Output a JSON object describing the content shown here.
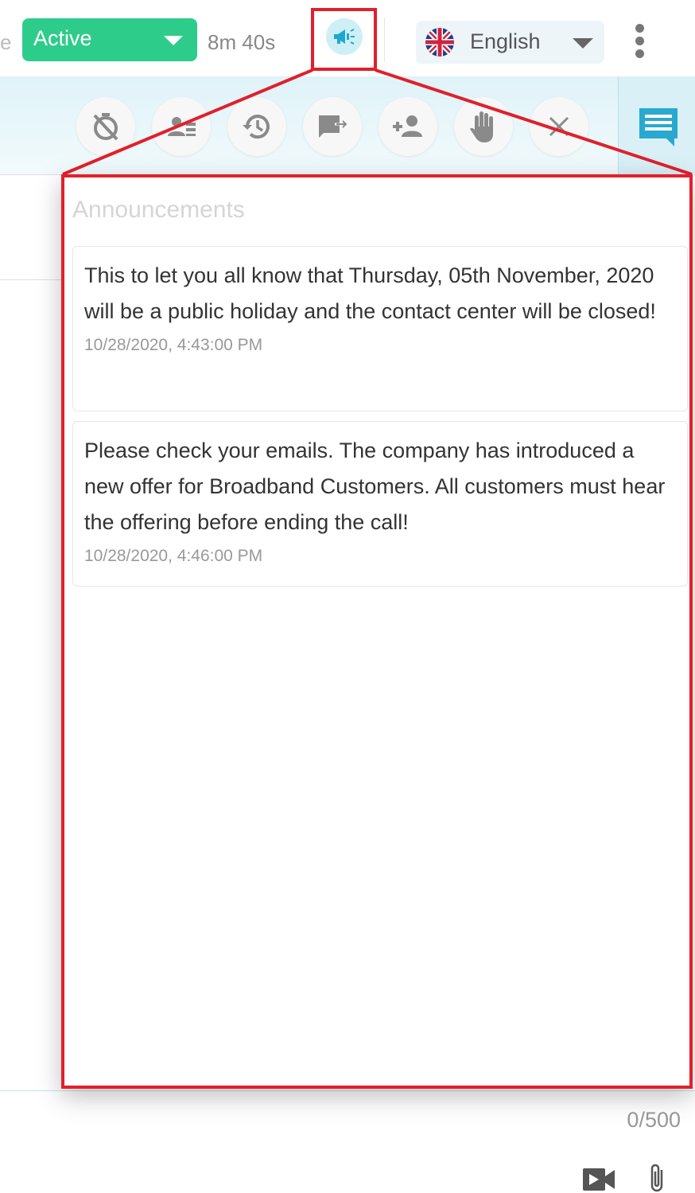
{
  "topbar": {
    "cut_letter": "e",
    "status_value": "Active",
    "timer": "8m 40s",
    "announcements_icon": "megaphone-icon",
    "language_value": "English",
    "language_flag": "uk-flag-icon",
    "more_icon": "kebab-menu-icon"
  },
  "toolbar": {
    "actions": [
      {
        "name": "timer-off-icon"
      },
      {
        "name": "contact-card-icon"
      },
      {
        "name": "history-icon"
      },
      {
        "name": "transfer-icon"
      },
      {
        "name": "add-user-icon"
      },
      {
        "name": "raise-hand-icon"
      },
      {
        "name": "close-icon"
      }
    ],
    "chat_panel_icon": "chat-icon"
  },
  "announcements": {
    "title": "Announcements",
    "items": [
      {
        "message": "This to let you all know that Thursday, 05th November, 2020 will be a public holiday and the contact center will be closed!",
        "timestamp": "10/28/2020, 4:43:00 PM"
      },
      {
        "message": "Please check your emails. The company has introduced a new offer for Broadband Customers. All customers must hear the offering before ending the call!",
        "timestamp": "10/28/2020, 4:46:00 PM"
      }
    ]
  },
  "composer": {
    "char_counter": "0/500",
    "video_icon": "video-camera-icon",
    "attach_icon": "paperclip-icon"
  },
  "colors": {
    "status_active": "#2ecc8a",
    "accent": "#29b6d8",
    "highlight": "#e0202c"
  }
}
